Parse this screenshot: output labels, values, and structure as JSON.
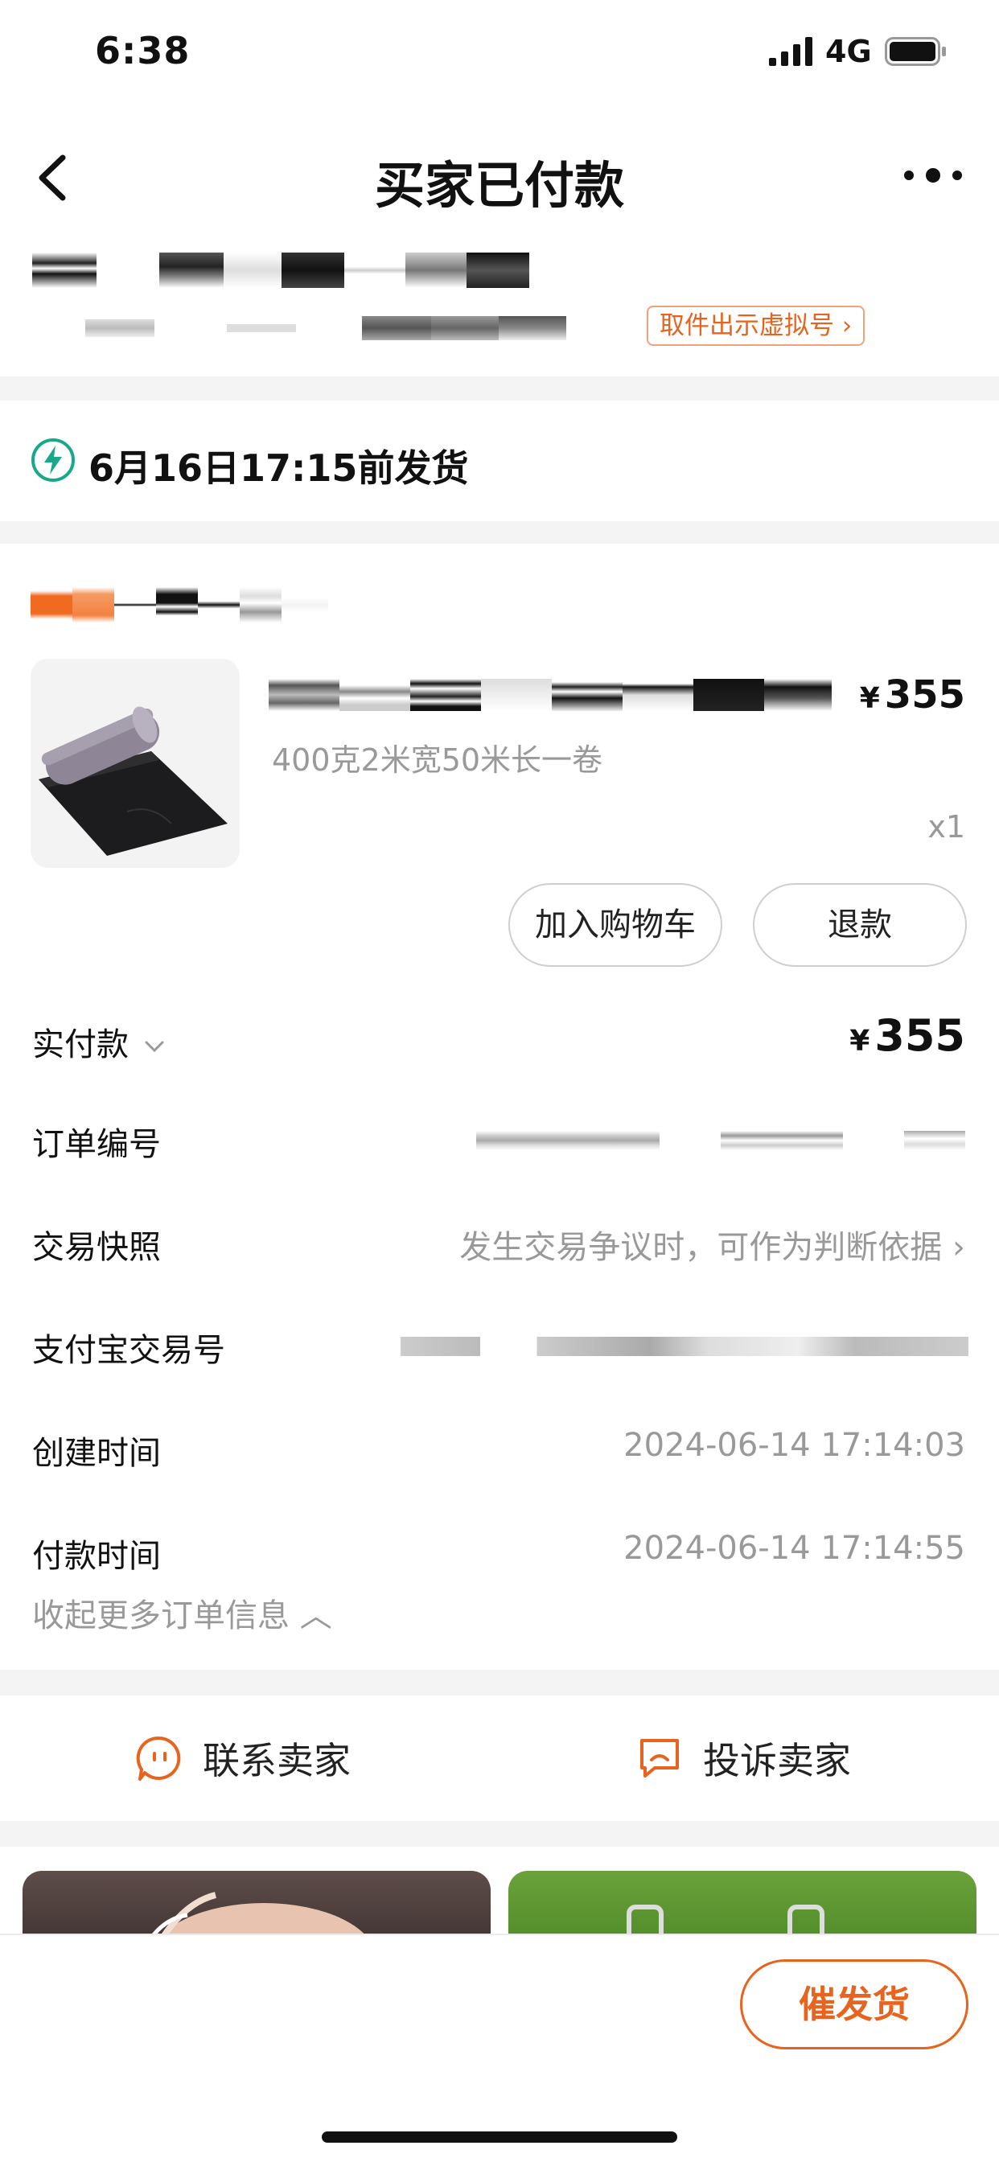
{
  "status_bar": {
    "time": "6:38",
    "network": "4G"
  },
  "nav": {
    "title": "买家已付款"
  },
  "address": {
    "virtual_number_button": "取件出示虚拟号 ›"
  },
  "shipping": {
    "deadline_text": "6月16日17:15前发货"
  },
  "item": {
    "spec": "400克2米宽50米长一卷",
    "price_symbol": "¥",
    "price": "355",
    "quantity": "x1",
    "add_to_cart_label": "加入购物车",
    "refund_label": "退款"
  },
  "order_info": {
    "total_label": "实付款",
    "total_symbol": "¥",
    "total_value": "355",
    "order_no_label": "订单编号",
    "snapshot_label": "交易快照",
    "snapshot_value": "发生交易争议时，可作为判断依据 ›",
    "alipay_label": "支付宝交易号",
    "created_label": "创建时间",
    "created_value": "2024-06-14 17:14:03",
    "paid_label": "付款时间",
    "paid_value": "2024-06-14 17:14:55",
    "collapse_label": "收起更多订单信息 ︿"
  },
  "contact": {
    "seller_label": "联系卖家",
    "complain_label": "投诉卖家"
  },
  "bottom": {
    "urge_label": "催发货"
  },
  "colors": {
    "accent": "#e8641e",
    "ship_icon": "#19a98a",
    "gray_text": "#999999"
  },
  "icons": [
    "back-icon",
    "more-icon",
    "lightning-icon",
    "chevron-down-icon",
    "chat-face-icon",
    "complaint-icon"
  ]
}
